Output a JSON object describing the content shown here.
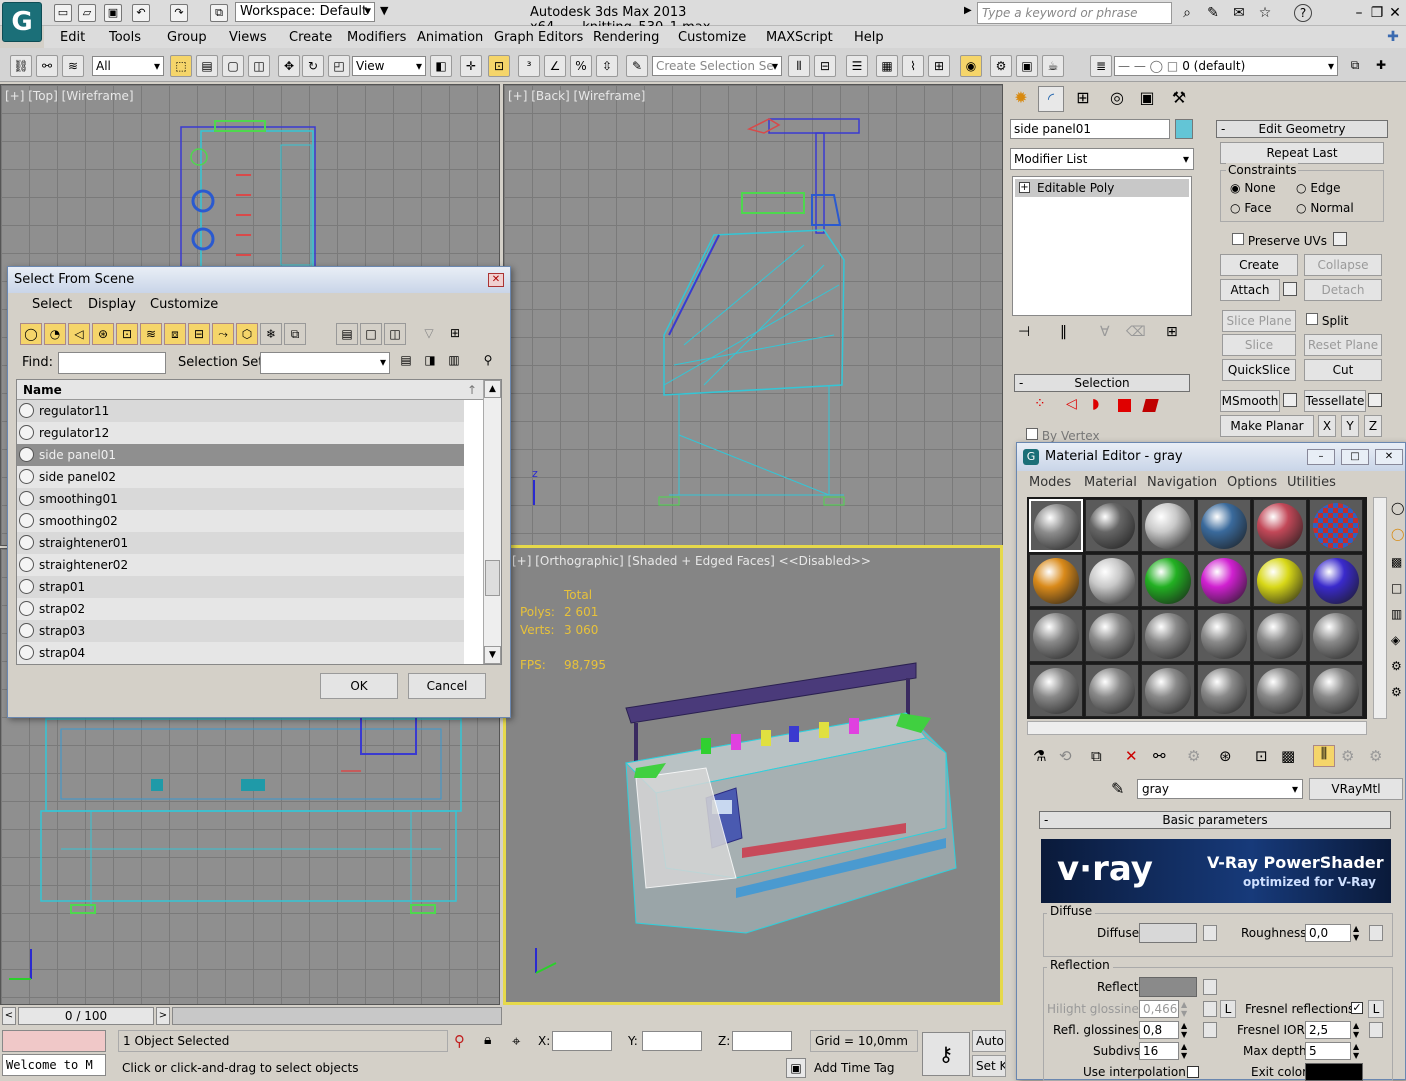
{
  "title_bar": {
    "app_logo": "G",
    "workspace": "Workspace: Default",
    "app_title": "Autodesk 3ds Max  2013 x64",
    "file_name": "knitting_530_1.max",
    "search_placeholder": "Type a keyword or phrase"
  },
  "menu": [
    "Edit",
    "Tools",
    "Group",
    "Views",
    "Create",
    "Modifiers",
    "Animation",
    "Graph Editors",
    "Rendering",
    "Customize",
    "MAXScript",
    "Help"
  ],
  "toolbar": {
    "filter": "All",
    "ref_coord": "View",
    "create_selection_set": "Create Selection Se",
    "layer": "0 (default)"
  },
  "viewports": {
    "top": "[+] [Top] [Wireframe]",
    "back": "[+] [Back] [Wireframe]",
    "persp": "[+] [Orthographic] [Shaded + Edged Faces]  <<Disabled>>",
    "stats": {
      "total_label": "Total",
      "polys_label": "Polys:",
      "polys_value": "2 601",
      "verts_label": "Verts:",
      "verts_value": "3 060",
      "fps_label": "FPS:",
      "fps_value": "98,795"
    }
  },
  "select_dialog": {
    "title": "Select From Scene",
    "menus": [
      "Select",
      "Display",
      "Customize"
    ],
    "find_label": "Find:",
    "selection_set_label": "Selection Set:",
    "column_name": "Name",
    "items": [
      "regulator11",
      "regulator12",
      "side panel01",
      "side panel02",
      "smoothing01",
      "smoothing02",
      "straightener01",
      "straightener02",
      "strap01",
      "strap02",
      "strap03",
      "strap04"
    ],
    "selected_index": 2,
    "ok": "OK",
    "cancel": "Cancel"
  },
  "command_panel": {
    "object_name": "side panel01",
    "object_color": "#63c5d6",
    "modifier_list": "Modifier List",
    "stack_item": "Editable Poly",
    "selection_rollout": "Selection",
    "by_vertex": "By Vertex"
  },
  "edit_geometry": {
    "header": "Edit Geometry",
    "repeat_last": "Repeat Last",
    "constraints": "Constraints",
    "none": "None",
    "edge": "Edge",
    "face": "Face",
    "normal": "Normal",
    "preserve_uvs": "Preserve UVs",
    "create": "Create",
    "collapse": "Collapse",
    "attach": "Attach",
    "detach": "Detach",
    "slice_plane": "Slice Plane",
    "split": "Split",
    "slice": "Slice",
    "reset_plane": "Reset Plane",
    "quickslice": "QuickSlice",
    "cut": "Cut",
    "msmooth": "MSmooth",
    "tessellate": "Tessellate",
    "make_planar": "Make Planar",
    "x": "X",
    "y": "Y",
    "z": "Z"
  },
  "material_editor": {
    "title": "Material Editor - gray",
    "menus": [
      "Modes",
      "Material",
      "Navigation",
      "Options",
      "Utilities"
    ],
    "material_name": "gray",
    "material_type": "VRayMtl",
    "basic_params": "Basic parameters",
    "vray_logo": "v·ray",
    "vray_title": "V-Ray PowerShader",
    "vray_subtitle": "optimized for V-Ray",
    "diffuse_group": "Diffuse",
    "diffuse": "Diffuse",
    "roughness": "Roughness",
    "roughness_value": "0,0",
    "reflection_group": "Reflection",
    "reflect": "Reflect",
    "hilight_glossiness": "Hilight glossiness",
    "hilight_value": "0,466",
    "l": "L",
    "fresnel_reflections": "Fresnel reflections",
    "refl_glossiness": "Refl. glossiness",
    "refl_gloss_value": "0,8",
    "fresnel_ior": "Fresnel IOR",
    "fresnel_ior_value": "2,5",
    "subdivs": "Subdivs",
    "subdivs_value": "16",
    "max_depth": "Max depth",
    "max_depth_value": "5",
    "use_interpolation": "Use interpolation",
    "exit_color": "Exit color",
    "spheres": [
      "#8c8c8c",
      "#666666",
      "#c9c9c9",
      "#3a6a9c",
      "#c24858",
      "checker",
      "#d98a1a",
      "#c8c8c8",
      "#22b022",
      "#d020d0",
      "#d8d818",
      "#3a2acc",
      "#8a8a8a",
      "#8a8a8a",
      "#8a8a8a",
      "#8a8a8a",
      "#8a8a8a",
      "#8a8a8a",
      "#8a8a8a",
      "#8a8a8a",
      "#8a8a8a",
      "#8a8a8a",
      "#8a8a8a",
      "#8a8a8a"
    ]
  },
  "status": {
    "timeline": "0 / 100",
    "listener": "Welcome to M",
    "objects_selected": "1 Object Selected",
    "prompt": "Click or click-and-drag to select objects",
    "x_label": "X:",
    "y_label": "Y:",
    "z_label": "Z:",
    "grid": "Grid = 10,0mm",
    "add_time_tag": "Add Time Tag",
    "auto_key": "Auto Ke",
    "set_key": "Set Ke"
  }
}
